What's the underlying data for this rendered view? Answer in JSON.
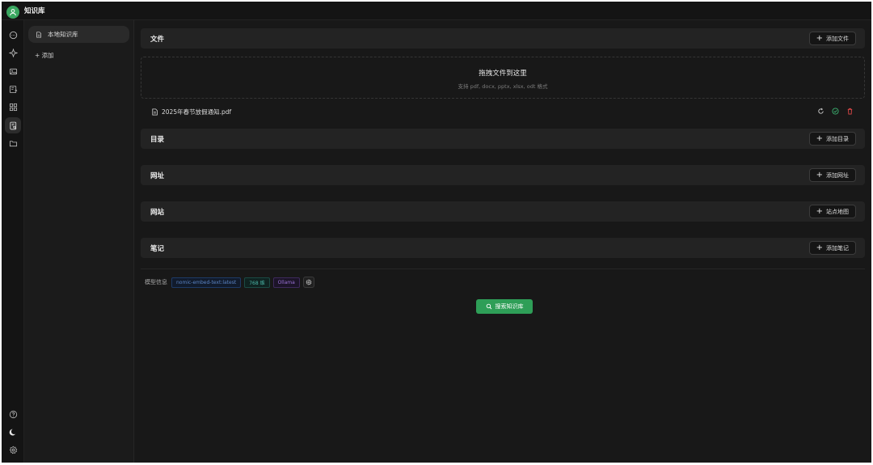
{
  "app": {
    "title": "知识库"
  },
  "sidebar_icons": [
    {
      "name": "chat-icon"
    },
    {
      "name": "sparkle-icon"
    },
    {
      "name": "image-icon"
    },
    {
      "name": "image-translate-icon"
    },
    {
      "name": "apps-grid-icon"
    },
    {
      "name": "knowledge-base-icon",
      "active": true
    },
    {
      "name": "folder-icon"
    }
  ],
  "sidebar_bottom_icons": [
    {
      "name": "help-icon"
    },
    {
      "name": "moon-icon"
    },
    {
      "name": "settings-gear-icon"
    }
  ],
  "knowledge_bases": {
    "items": [
      {
        "label": "本地知识库",
        "icon": "document-icon"
      }
    ],
    "add_label": "+ 添加"
  },
  "sections": {
    "files": {
      "title": "文件",
      "button": "添加文件"
    },
    "directories": {
      "title": "目录",
      "button": "添加目录"
    },
    "urls": {
      "title": "网址",
      "button": "添加网址"
    },
    "websites": {
      "title": "网站",
      "button": "站点地图"
    },
    "notes": {
      "title": "笔记",
      "button": "添加笔记"
    }
  },
  "dropzone": {
    "title": "拖拽文件到这里",
    "subtitle": "支持 pdf, docx, pptx, xlsx, odt 格式"
  },
  "files": [
    {
      "name": "2025年春节放假通知.pdf",
      "actions": [
        "refresh-icon",
        "check-circle-icon",
        "delete-icon"
      ]
    }
  ],
  "model_info": {
    "label": "模型信息",
    "model": "nomic-embed-text:latest",
    "dimensions": "768 维",
    "provider": "Ollama"
  },
  "search_button": "搜索知识库",
  "colors": {
    "accent_green": "#2e9e57",
    "check_green": "#3cb371",
    "delete_red": "#e04848",
    "tag_blue": "#5b84c4",
    "tag_cyan": "#4bb7a8",
    "tag_purple": "#9a72d6"
  }
}
